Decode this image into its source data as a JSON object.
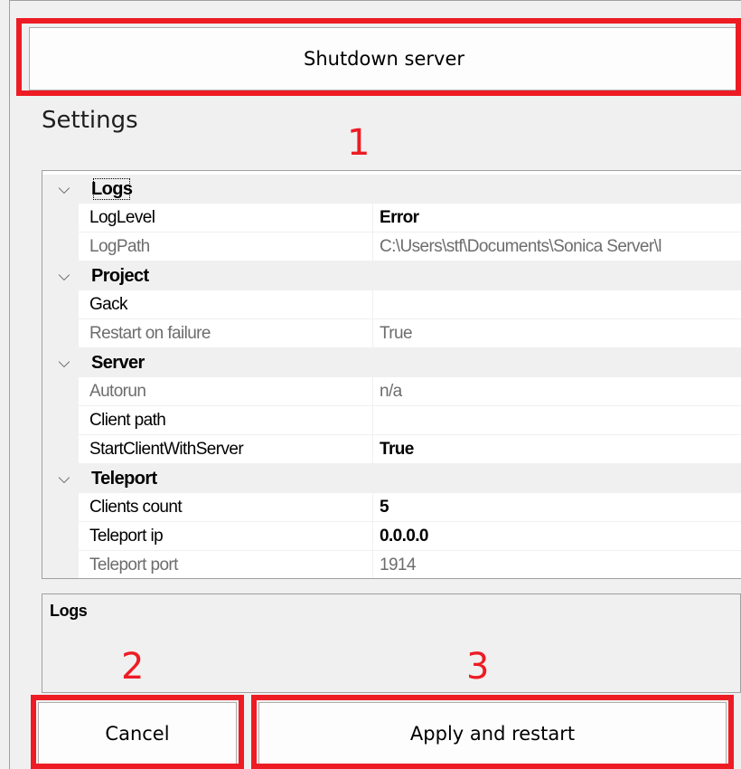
{
  "shutdown_button": {
    "label": "Shutdown server"
  },
  "settings": {
    "title": "Settings"
  },
  "annotations": {
    "n1": "1",
    "n2": "2",
    "n3": "3"
  },
  "property_grid": {
    "categories": [
      {
        "name": "Logs",
        "properties": [
          {
            "name": "LogLevel",
            "value": "Error",
            "bold": true,
            "readonly": false
          },
          {
            "name": "LogPath",
            "value": "C:\\Users\\stf\\Documents\\Sonica Server\\l",
            "bold": false,
            "readonly": true
          }
        ]
      },
      {
        "name": "Project",
        "properties": [
          {
            "name": "Gack",
            "value": "",
            "bold": false,
            "readonly": false
          },
          {
            "name": "Restart on failure",
            "value": "True",
            "bold": false,
            "readonly": true
          }
        ]
      },
      {
        "name": "Server",
        "properties": [
          {
            "name": "Autorun",
            "value": "n/a",
            "bold": false,
            "readonly": true
          },
          {
            "name": "Client path",
            "value": "",
            "bold": false,
            "readonly": false
          },
          {
            "name": "StartClientWithServer",
            "value": "True",
            "bold": true,
            "readonly": false
          }
        ]
      },
      {
        "name": "Teleport",
        "properties": [
          {
            "name": "Clients count",
            "value": "5",
            "bold": true,
            "readonly": false
          },
          {
            "name": "Teleport ip",
            "value": "0.0.0.0",
            "bold": true,
            "readonly": false
          },
          {
            "name": "Teleport port",
            "value": "1914",
            "bold": false,
            "readonly": true
          }
        ]
      }
    ]
  },
  "logs_panel": {
    "title": "Logs"
  },
  "cancel_button": {
    "label": "Cancel"
  },
  "apply_button": {
    "label": "Apply and restart"
  },
  "colors": {
    "highlight": "#ed1c24"
  }
}
